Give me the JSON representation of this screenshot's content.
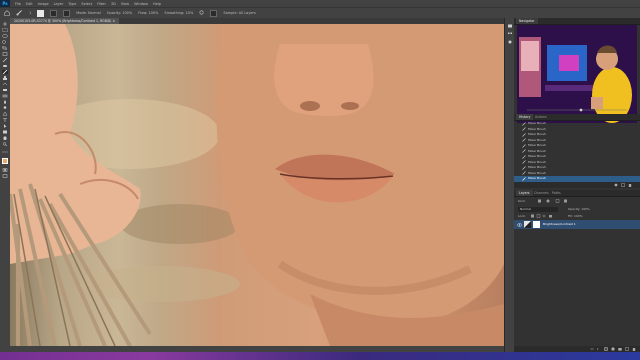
{
  "app": {
    "logo": "Ps"
  },
  "menu": [
    "File",
    "Edit",
    "Image",
    "Layer",
    "Type",
    "Select",
    "Filter",
    "3D",
    "View",
    "Window",
    "Help"
  ],
  "options_bar": {
    "size": "1",
    "mode_label": "Mode: Normal",
    "opacity": "Opacity: 100%",
    "flow": "Flow: 100%",
    "smoothing": "Smoothing: 10%",
    "sample": "Sample: All Layers"
  },
  "document": {
    "tab_title": "20200105-0R-S3774 @ 300% (Brightness/Contrast 1, RGB/8) ×"
  },
  "navigator": {
    "tab": "Navigator"
  },
  "history": {
    "tabs": [
      "History",
      "Actions"
    ],
    "items": [
      "Mixer Brush",
      "Mixer Brush",
      "Mixer Brush",
      "Mixer Brush",
      "Mixer Brush",
      "Mixer Brush",
      "Mixer Brush",
      "Mixer Brush",
      "Mixer Brush",
      "Mixer Brush",
      "Mixer Brush"
    ]
  },
  "layers": {
    "tabs": [
      "Layers",
      "Channels",
      "Paths"
    ],
    "kind": "Kind",
    "blend": "Normal",
    "opacity": "Opacity: 100%",
    "fill": "Fill: 100%",
    "lock": "Lock:",
    "items": [
      {
        "name": "Brightness/Contrast 1"
      }
    ]
  },
  "colors": {
    "accent": "#31a8ff",
    "selection": "#2f5d8a",
    "panel_bg": "#323232"
  }
}
